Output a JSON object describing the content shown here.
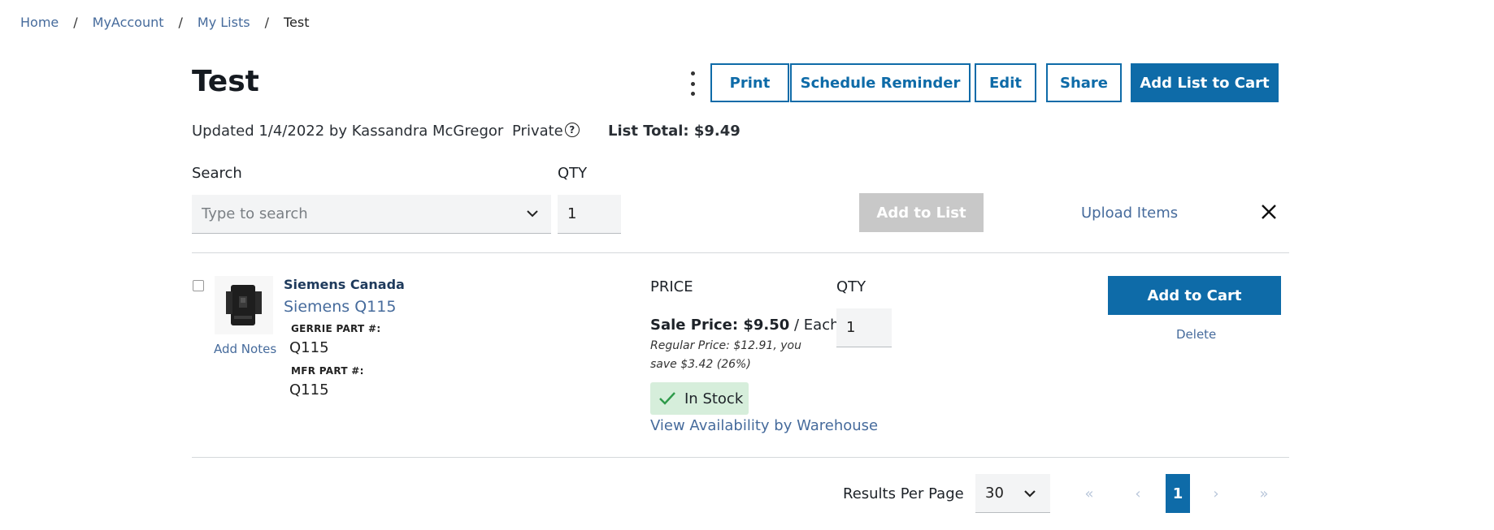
{
  "breadcrumb": {
    "items": [
      "Home",
      "MyAccount",
      "My Lists"
    ],
    "separator": "/",
    "current": "Test"
  },
  "page": {
    "title": "Test",
    "updated_text": "Updated 1/4/2022 by Kassandra McGregor",
    "privacy": "Private",
    "list_total": "List Total: $9.49"
  },
  "header_actions": {
    "print": "Print",
    "schedule_reminder": "Schedule Reminder",
    "edit": "Edit",
    "share": "Share",
    "add_list_to_cart": "Add List to Cart"
  },
  "add_form": {
    "search_label": "Search",
    "search_placeholder": "Type to search",
    "qty_label": "QTY",
    "qty_value": "1",
    "add_to_list": "Add to List",
    "upload_items": "Upload Items"
  },
  "items": [
    {
      "brand": "Siemens Canada",
      "name": "Siemens Q115",
      "add_notes": "Add Notes",
      "gerrie_part_label": "GERRIE PART #:",
      "gerrie_part": "Q115",
      "mfr_part_label": "MFR PART #:",
      "mfr_part": "Q115",
      "price_header": "PRICE",
      "qty_header": "QTY",
      "sale_label": "Sale Price: $9.50",
      "unit": " / Each",
      "regular_price": "Regular Price: $12.91, you save $3.42 (26%)",
      "stock": "In Stock",
      "availability_link": "View Availability by Warehouse",
      "qty": "1",
      "add_to_cart": "Add to Cart",
      "delete": "Delete"
    }
  ],
  "pagination": {
    "results_per_page_label": "Results Per Page",
    "results_per_page": "30",
    "first": "«",
    "prev": "‹",
    "current_page": "1",
    "next": "›",
    "last": "»"
  },
  "colors": {
    "primary": "#0e6ba8",
    "link": "#466b9c",
    "in_stock_bg": "#d6eedb",
    "disabled": "#c8c8c8"
  }
}
